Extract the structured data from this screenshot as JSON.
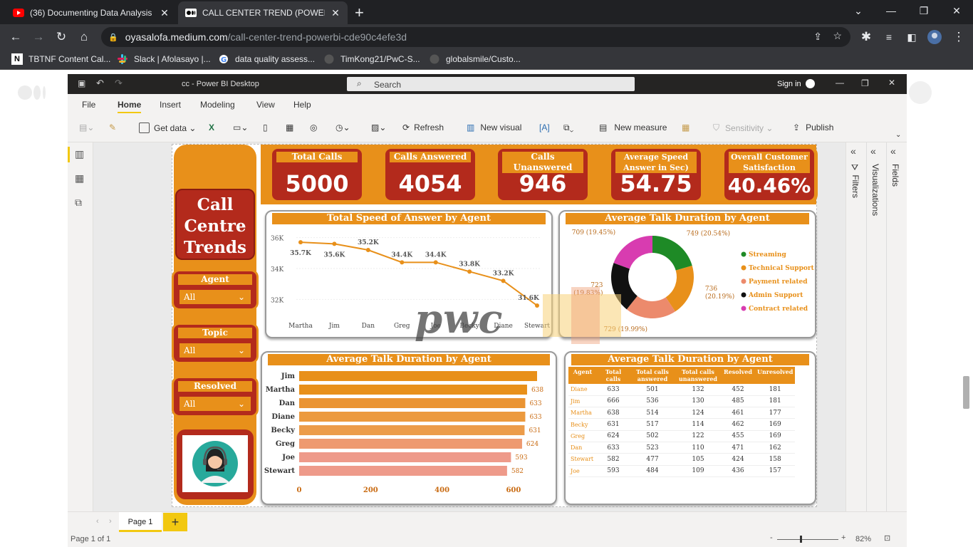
{
  "browser": {
    "tabs": [
      {
        "title": "(36) Documenting Data Analysis",
        "icon": "youtube-icon"
      },
      {
        "title": "CALL CENTER TREND (POWERBI)",
        "icon": "medium-icon"
      }
    ],
    "new_tab": "+",
    "url_host": "oyasalofa.medium.com",
    "url_path": "/call-center-trend-powerbi-cde90c4efe3d",
    "bookmarks": [
      "TBTNF Content Cal...",
      "Slack | Afolasayo |...",
      "data quality assess...",
      "TimKong21/PwC-S...",
      "globalsmile/Custo..."
    ]
  },
  "pbi": {
    "window_title": "cc - Power BI Desktop",
    "search_placeholder": "Search",
    "sign_in": "Sign in",
    "ribbon_tabs": [
      "File",
      "Home",
      "Insert",
      "Modeling",
      "View",
      "Help"
    ],
    "ribbon_tools": {
      "get_data": "Get data",
      "refresh": "Refresh",
      "new_visual": "New visual",
      "new_measure": "New measure",
      "sensitivity": "Sensitivity",
      "publish": "Publish"
    },
    "panes": [
      "Filters",
      "Visualizations",
      "Fields"
    ],
    "page_tab": "Page 1",
    "add_page": "+",
    "status": "Page 1 of 1",
    "zoom": "82%"
  },
  "report": {
    "title_lines": [
      "Call",
      "Centre",
      "Trends"
    ],
    "slicers": [
      {
        "label": "Agent",
        "value": "All"
      },
      {
        "label": "Topic",
        "value": "All"
      },
      {
        "label": "Resolved",
        "value": "All"
      }
    ],
    "kpis": [
      {
        "title": "Total Calls",
        "value": "5000"
      },
      {
        "title": "Calls Answered",
        "value": "4054"
      },
      {
        "title": "Calls Unanswered",
        "value": "946"
      },
      {
        "title": "Average Speed Answer in Sec)",
        "value": "54.75"
      },
      {
        "title": "Overall Customer Satisfaction",
        "value": "40.46%"
      }
    ],
    "watermark": "pwc"
  },
  "chart_data": [
    {
      "type": "line",
      "title": "Total Speed of Answer by Agent",
      "categories": [
        "Martha",
        "Jim",
        "Dan",
        "Greg",
        "Joe",
        "Becky",
        "Diane",
        "Stewart"
      ],
      "values": [
        35.7,
        35.6,
        35.2,
        34.4,
        34.4,
        33.8,
        33.2,
        31.6
      ],
      "data_labels": [
        "35.7K",
        "35.6K",
        "35.2K",
        "34.4K",
        "34.4K",
        "33.8K",
        "33.2K",
        "31.6K"
      ],
      "y_ticks": [
        "36K",
        "34K",
        "32K"
      ],
      "ylim": [
        31.6,
        36.4
      ],
      "color": "#e8901a"
    },
    {
      "type": "pie",
      "title": "Average Talk Duration by Agent",
      "labels": [
        "Streaming",
        "Technical Support",
        "Payment related",
        "Admin Support",
        "Contract related"
      ],
      "values": [
        749,
        736,
        729,
        723,
        709
      ],
      "data_labels": [
        "749 (20.54%)",
        "736 (20.19%)",
        "729 (19.99%)",
        "723 (19.83%)",
        "709 (19.45%)"
      ],
      "colors": [
        "#1e8a26",
        "#e8901a",
        "#ec8a6c",
        "#111111",
        "#d83cb0"
      ],
      "legend": "right"
    },
    {
      "type": "bar",
      "title": "Average Talk Duration by Agent",
      "categories": [
        "Jim",
        "Martha",
        "Dan",
        "Diane",
        "Becky",
        "Greg",
        "Joe",
        "Stewart"
      ],
      "values": [
        666,
        638,
        633,
        633,
        631,
        624,
        593,
        582
      ],
      "data_labels": [
        "",
        "638",
        "633",
        "633",
        "631",
        "624",
        "593",
        "582"
      ],
      "x_ticks": [
        "0",
        "200",
        "400",
        "600"
      ],
      "xlim": [
        0,
        666
      ],
      "orientation": "horizontal"
    },
    {
      "type": "table",
      "title": "Average Talk Duration by Agent",
      "columns": [
        "Agent",
        "Total calls",
        "Total calls answered",
        "Total calls unanswered",
        "Resolved",
        "Unresolved"
      ],
      "rows": [
        [
          "Diane",
          "633",
          "501",
          "132",
          "452",
          "181"
        ],
        [
          "Jim",
          "666",
          "536",
          "130",
          "485",
          "181"
        ],
        [
          "Martha",
          "638",
          "514",
          "124",
          "461",
          "177"
        ],
        [
          "Becky",
          "631",
          "517",
          "114",
          "462",
          "169"
        ],
        [
          "Greg",
          "624",
          "502",
          "122",
          "455",
          "169"
        ],
        [
          "Dan",
          "633",
          "523",
          "110",
          "471",
          "162"
        ],
        [
          "Stewart",
          "582",
          "477",
          "105",
          "424",
          "158"
        ],
        [
          "Joe",
          "593",
          "484",
          "109",
          "436",
          "157"
        ]
      ]
    }
  ]
}
